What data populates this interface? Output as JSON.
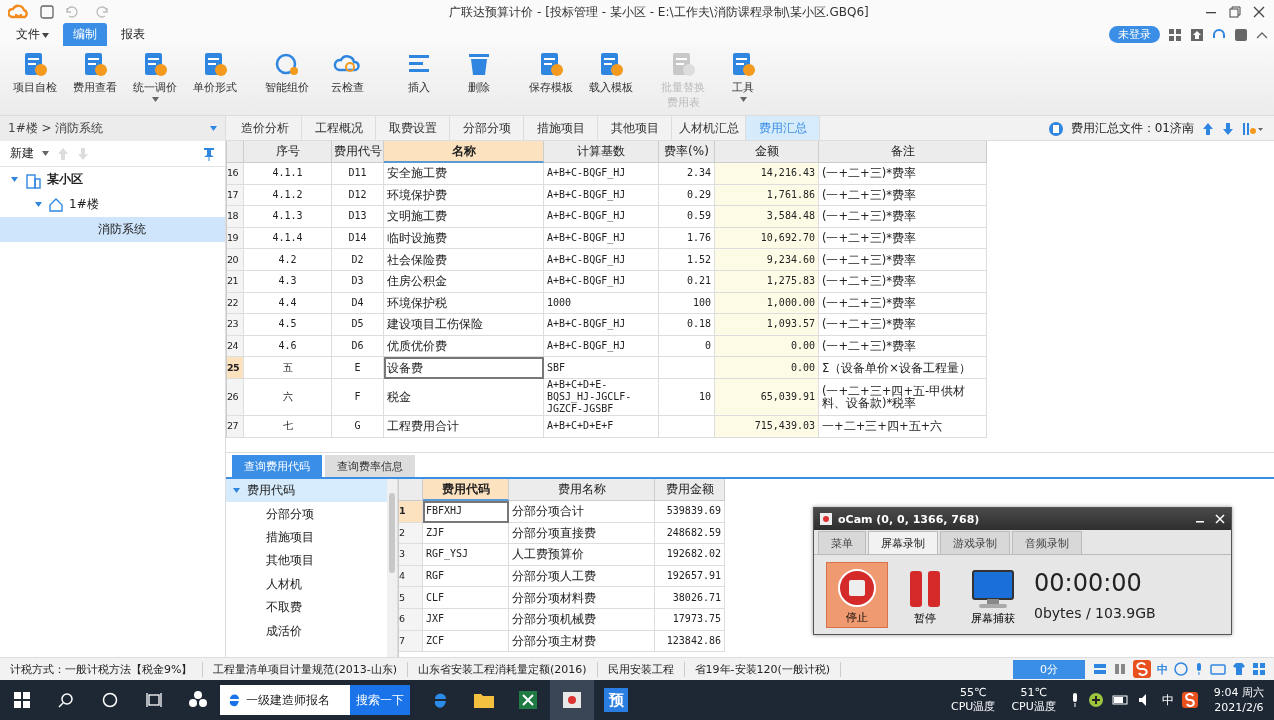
{
  "app": {
    "title": "广联达预算计价 - [投标管理 - 某小区 - E:\\工作夫\\消防课程录制\\某小区.GBQ6]",
    "login": "未登录"
  },
  "menu": [
    {
      "label": "文件",
      "selected": false,
      "caret": true
    },
    {
      "label": "编制",
      "selected": true,
      "caret": false
    },
    {
      "label": "报表",
      "selected": false,
      "caret": false
    }
  ],
  "toolbar": [
    {
      "label": "项目自检",
      "disabled": false,
      "caret": false
    },
    {
      "label": "费用查看",
      "disabled": false,
      "caret": false
    },
    {
      "label": "统一调价",
      "disabled": false,
      "caret": true
    },
    {
      "label": "单价形式",
      "disabled": false,
      "caret": false
    },
    {
      "label": "智能组价",
      "disabled": false,
      "caret": false
    },
    {
      "label": "云检查",
      "disabled": false,
      "caret": false
    },
    {
      "label": "插入",
      "disabled": false,
      "caret": false
    },
    {
      "label": "删除",
      "disabled": false,
      "caret": false
    },
    {
      "label": "保存模板",
      "disabled": false,
      "caret": false
    },
    {
      "label": "载入模板",
      "disabled": false,
      "caret": false
    },
    {
      "label": "批量替换费用表",
      "disabled": true,
      "caret": false
    },
    {
      "label": "工具",
      "disabled": false,
      "caret": true
    }
  ],
  "left_panel": {
    "path": "1#楼 > 消防系统",
    "new_label": "新建",
    "tree": [
      {
        "label": "某小区",
        "expanded": true,
        "selected": false,
        "children": [
          {
            "label": "1#楼",
            "expanded": true,
            "selected": false,
            "children": [
              {
                "label": "消防系统",
                "selected": true
              }
            ]
          }
        ]
      }
    ]
  },
  "tabs": [
    {
      "label": "造价分析",
      "selected": false
    },
    {
      "label": "工程概况",
      "selected": false
    },
    {
      "label": "取费设置",
      "selected": false
    },
    {
      "label": "分部分项",
      "selected": false
    },
    {
      "label": "措施项目",
      "selected": false
    },
    {
      "label": "其他项目",
      "selected": false
    },
    {
      "label": "人材机汇总",
      "selected": false
    },
    {
      "label": "费用汇总",
      "selected": true
    }
  ],
  "summary_file": "费用汇总文件：01济南",
  "fee_table": {
    "columns": [
      {
        "label": "序号",
        "selected": false
      },
      {
        "label": "费用代号",
        "selected": false
      },
      {
        "label": "名称",
        "selected": true
      },
      {
        "label": "计算基数",
        "selected": false
      },
      {
        "label": "费率(%)",
        "selected": false
      },
      {
        "label": "金额",
        "selected": false
      },
      {
        "label": "备注",
        "selected": false
      }
    ],
    "rows": [
      {
        "no": "16",
        "selected": false,
        "seq": "4.1.1",
        "code": "D11",
        "name": "安全施工费",
        "base": "A+B+C-BQGF_HJ",
        "rate": "2.34",
        "amount": "14,216.43",
        "note": "(一+二+三)*费率"
      },
      {
        "no": "17",
        "selected": false,
        "seq": "4.1.2",
        "code": "D12",
        "name": "环境保护费",
        "base": "A+B+C-BQGF_HJ",
        "rate": "0.29",
        "amount": "1,761.86",
        "note": "(一+二+三)*费率"
      },
      {
        "no": "18",
        "selected": false,
        "seq": "4.1.3",
        "code": "D13",
        "name": "文明施工费",
        "base": "A+B+C-BQGF_HJ",
        "rate": "0.59",
        "amount": "3,584.48",
        "note": "(一+二+三)*费率"
      },
      {
        "no": "19",
        "selected": false,
        "seq": "4.1.4",
        "code": "D14",
        "name": "临时设施费",
        "base": "A+B+C-BQGF_HJ",
        "rate": "1.76",
        "amount": "10,692.70",
        "note": "(一+二+三)*费率"
      },
      {
        "no": "20",
        "selected": false,
        "seq": "4.2",
        "code": "D2",
        "name": "社会保险费",
        "base": "A+B+C-BQGF_HJ",
        "rate": "1.52",
        "amount": "9,234.60",
        "note": "(一+二+三)*费率"
      },
      {
        "no": "21",
        "selected": false,
        "seq": "4.3",
        "code": "D3",
        "name": "住房公积金",
        "base": "A+B+C-BQGF_HJ",
        "rate": "0.21",
        "amount": "1,275.83",
        "note": "(一+二+三)*费率"
      },
      {
        "no": "22",
        "selected": false,
        "seq": "4.4",
        "code": "D4",
        "name": "环境保护税",
        "base": "1000",
        "rate": "100",
        "amount": "1,000.00",
        "note": "(一+二+三)*费率"
      },
      {
        "no": "23",
        "selected": false,
        "seq": "4.5",
        "code": "D5",
        "name": "建设项目工伤保险",
        "base": "A+B+C-BQGF_HJ",
        "rate": "0.18",
        "amount": "1,093.57",
        "note": "(一+二+三)*费率"
      },
      {
        "no": "24",
        "selected": false,
        "seq": "4.6",
        "code": "D6",
        "name": "优质优价费",
        "base": "A+B+C-BQGF_HJ",
        "rate": "0",
        "amount": "0.00",
        "note": "(一+二+三)*费率"
      },
      {
        "no": "25",
        "selected": true,
        "seq": "五",
        "code": "E",
        "name": "设备费",
        "base": "SBF",
        "amount": "0.00",
        "note": "Σ（设备单价×设备工程量）"
      },
      {
        "no": "26",
        "selected": false,
        "seq": "六",
        "code": "F",
        "name": "税金",
        "base": "A+B+C+D+E-BQSJ_HJ-JGCLF-JGZCF-JGSBF",
        "rate": "10",
        "amount": "65,039.91",
        "note": "(一+二+三+四+五-甲供材料、设备款)*税率"
      },
      {
        "no": "27",
        "selected": false,
        "seq": "七",
        "code": "G",
        "name": "工程费用合计",
        "base": "A+B+C+D+E+F",
        "amount": "715,439.03",
        "note": "一+二+三+四+五+六"
      }
    ]
  },
  "lookup": {
    "tabs": [
      {
        "label": "查询费用代码",
        "selected": true
      },
      {
        "label": "查询费率信息",
        "selected": false
      }
    ],
    "tree": [
      {
        "label": "费用代码",
        "expanded": true,
        "selected": true,
        "children": [
          {
            "label": "分部分项"
          },
          {
            "label": "措施项目"
          },
          {
            "label": "其他项目"
          },
          {
            "label": "人材机"
          },
          {
            "label": "不取费"
          },
          {
            "label": "成活价"
          }
        ]
      }
    ],
    "columns": [
      {
        "label": "费用代码",
        "selected": true
      },
      {
        "label": "费用名称",
        "selected": false
      },
      {
        "label": "费用金额",
        "selected": false
      }
    ],
    "rows": [
      {
        "no": "1",
        "selected": true,
        "code": "FBFXHJ",
        "name": "分部分项合计",
        "amount": "539839.69"
      },
      {
        "no": "2",
        "selected": false,
        "code": "ZJF",
        "name": "分部分项直接费",
        "amount": "248682.59"
      },
      {
        "no": "3",
        "selected": false,
        "code": "RGF_YSJ",
        "name": "人工费预算价",
        "amount": "192682.02"
      },
      {
        "no": "4",
        "selected": false,
        "code": "RGF",
        "name": "分部分项人工费",
        "amount": "192657.91"
      },
      {
        "no": "5",
        "selected": false,
        "code": "CLF",
        "name": "分部分项材料费",
        "amount": "38026.71"
      },
      {
        "no": "6",
        "selected": false,
        "code": "JXF",
        "name": "分部分项机械费",
        "amount": "17973.75"
      },
      {
        "no": "7",
        "selected": false,
        "code": "ZCF",
        "name": "分部分项主材费",
        "amount": "123842.86"
      }
    ]
  },
  "recorder": {
    "title": "oCam (0, 0, 1366, 768)",
    "tabs": [
      {
        "label": "菜单",
        "selected": false
      },
      {
        "label": "屏幕录制",
        "selected": true
      },
      {
        "label": "游戏录制",
        "selected": false
      },
      {
        "label": "音频录制",
        "selected": false
      }
    ],
    "buttons": [
      {
        "label": "停止",
        "selected": true
      },
      {
        "label": "暂停",
        "selected": false
      },
      {
        "label": "屏幕捕获",
        "selected": false
      }
    ],
    "time": "00:00:00",
    "size": "0bytes / 103.9GB"
  },
  "status_bar": {
    "items": [
      "计税方式：一般计税方法【税金9%】",
      "工程量清单项目计量规范(2013-山东)",
      "山东省安装工程消耗量定额(2016)",
      "民用安装工程",
      "省19年-安装120(一般计税)"
    ],
    "score": "0分",
    "ime": "中"
  },
  "taskbar": {
    "search_text": "一级建造师报名",
    "search_button": "搜索一下",
    "app_glyph": "预",
    "sensors": [
      {
        "value": "55℃",
        "label": "CPU温度"
      },
      {
        "value": "51℃",
        "label": "CPU温度"
      }
    ],
    "ime": "中",
    "time": "9:04 周六",
    "date": "2021/2/6"
  }
}
